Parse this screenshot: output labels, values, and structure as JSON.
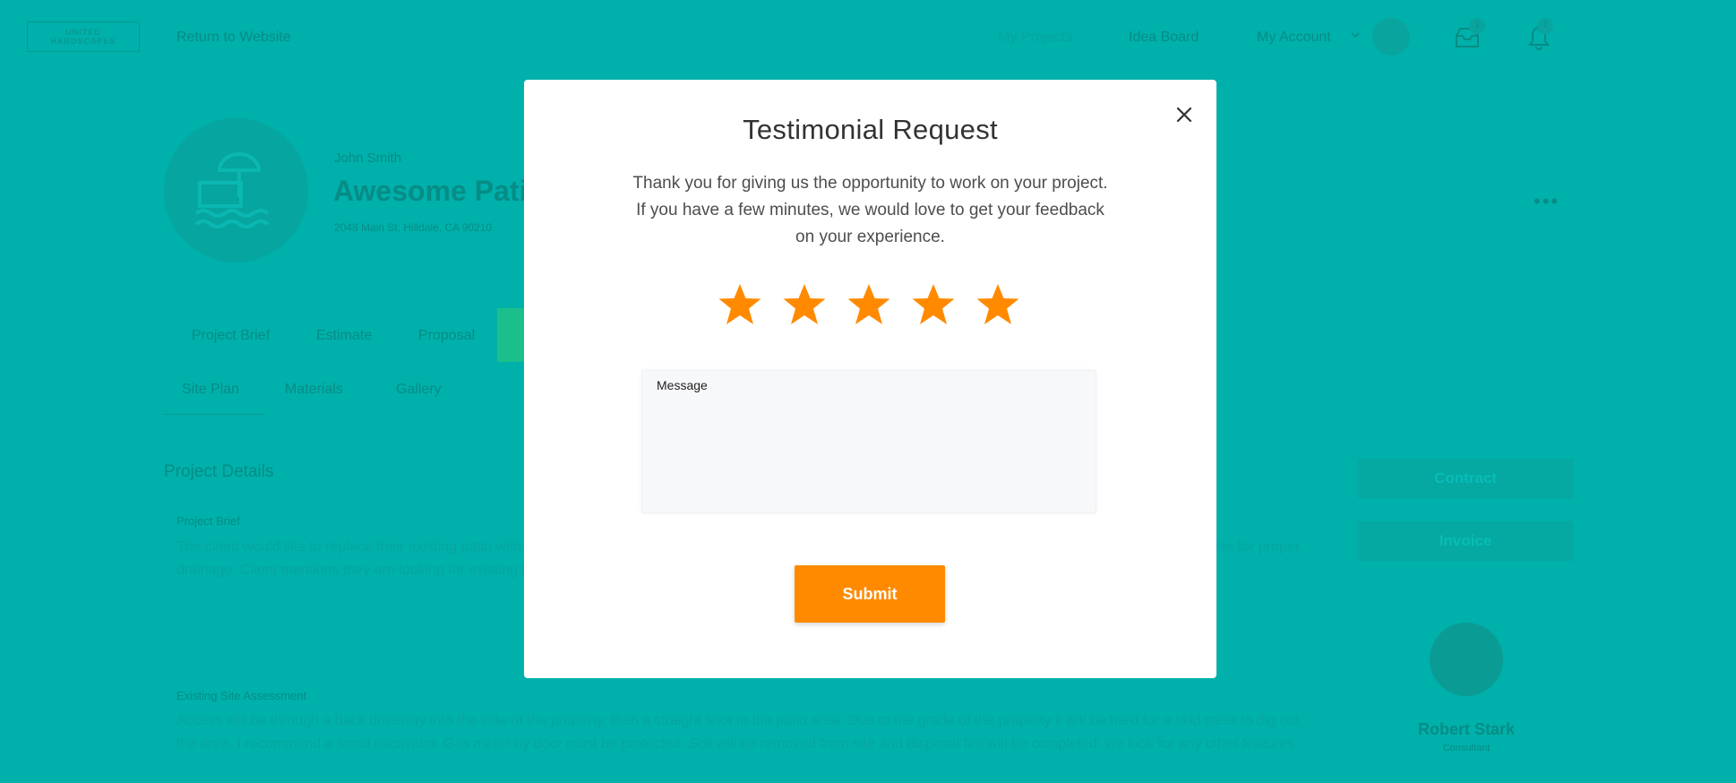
{
  "app": {
    "logo_line1": "UNITED",
    "logo_line2": "HARDSCAPES",
    "return_link": "Return to Website",
    "nav": {
      "my_projects": "My Projects",
      "idea_board": "Idea Board",
      "my_account": "My Account",
      "inbox_badge": "1",
      "notif_badge": "1"
    }
  },
  "project": {
    "owner": "John Smith",
    "title": "Awesome Patio Project",
    "address": "2048 Main St, Hilldale, CA 90210",
    "tabs": [
      "Project Brief",
      "Estimate",
      "Proposal"
    ],
    "subtabs": [
      "Site Plan",
      "Materials",
      "Gallery"
    ],
    "section_title": "Project Details",
    "brief_label": "Project Brief",
    "brief_text": "The client would like to replace their existing patio with a new paver patio. Please take into account all specifications from the client. Ensure slope away from the house for proper drainage. Client mentions they are looking for existing brick steps removed as well.",
    "assessment_label": "Existing Site Assessment",
    "assessment_text": "Access will be through a back driveway into the side of the property, then a straight shot to the patio area. Due to the grade of the property it will be hard for a skid steer to dig out the area. I recommend a small excavator. Gas meter by door must be protected. Soil will be removed from site and disposal fee will be completed; we look for any other features."
  },
  "sidebar": {
    "contract_button": "Contract",
    "invoice_button": "Invoice",
    "contact_name": "Robert Stark",
    "contact_role": "Consultant"
  },
  "modal": {
    "title": "Testimonial Request",
    "body_lines": [
      "Thank you for giving us the opportunity to work on your project.",
      "If you have a few minutes, we would love to get your feedback",
      "on your experience."
    ],
    "rating": 5,
    "max_rating": 5,
    "message_label": "Message",
    "message_value": "",
    "submit_label": "Submit",
    "star_color": "#ff8a00",
    "submit_color": "#ff8a00"
  },
  "colors": {
    "overlay_teal": "#00b0aa",
    "accent_orange": "#ff8a00"
  }
}
